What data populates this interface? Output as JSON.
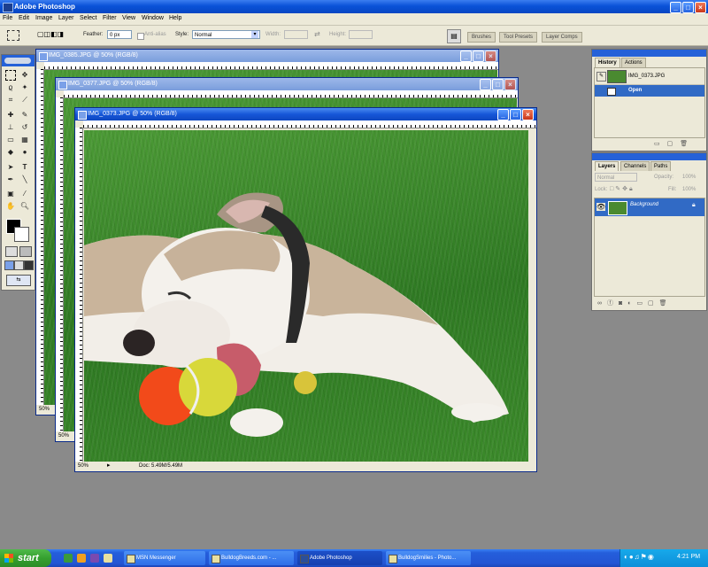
{
  "app": {
    "title": "Adobe Photoshop",
    "menu": [
      "File",
      "Edit",
      "Image",
      "Layer",
      "Select",
      "Filter",
      "View",
      "Window",
      "Help"
    ]
  },
  "options_bar": {
    "feather_label": "Feather:",
    "feather_value": "0 px",
    "antialias_label": "Anti-alias",
    "style_label": "Style:",
    "style_value": "Normal",
    "width_label": "Width:",
    "height_label": "Height:",
    "palette_tabs": [
      "Brushes",
      "Tool Presets",
      "Layer Comps"
    ]
  },
  "documents": [
    {
      "title": "IMG_0385.JPG @ 50% (RGB/8)",
      "zoom": "50%"
    },
    {
      "title": "IMG_0377.JPG @ 50% (RGB/8)",
      "zoom": "50%"
    },
    {
      "title": "IMG_0373.JPG @ 50% (RGB/8)",
      "zoom": "50%",
      "doc_info": "Doc: 5.49M/5.49M"
    }
  ],
  "history_panel": {
    "tabs": [
      "History",
      "Actions"
    ],
    "snapshot": "IMG_0373.JPG",
    "states": [
      "Open"
    ]
  },
  "layers_panel": {
    "tabs": [
      "Layers",
      "Channels",
      "Paths"
    ],
    "blend_mode": "Normal",
    "opacity_label": "Opacity:",
    "opacity_value": "100%",
    "lock_label": "Lock:",
    "fill_label": "Fill:",
    "fill_value": "100%",
    "layers": [
      "Background"
    ]
  },
  "taskbar": {
    "start_label": "start",
    "tasks": [
      "MSN Messenger",
      "BulldogBreeds.com - ...",
      "Adobe Photoshop",
      "BulldogSmilies - Photo..."
    ],
    "clock": "4:21 PM"
  },
  "colors": {
    "title_blue": "#0a52d8",
    "panel_bg": "#ece9d8",
    "selection_blue": "#316ac5",
    "taskbar_blue": "#245edb",
    "start_green": "#35a02f"
  }
}
